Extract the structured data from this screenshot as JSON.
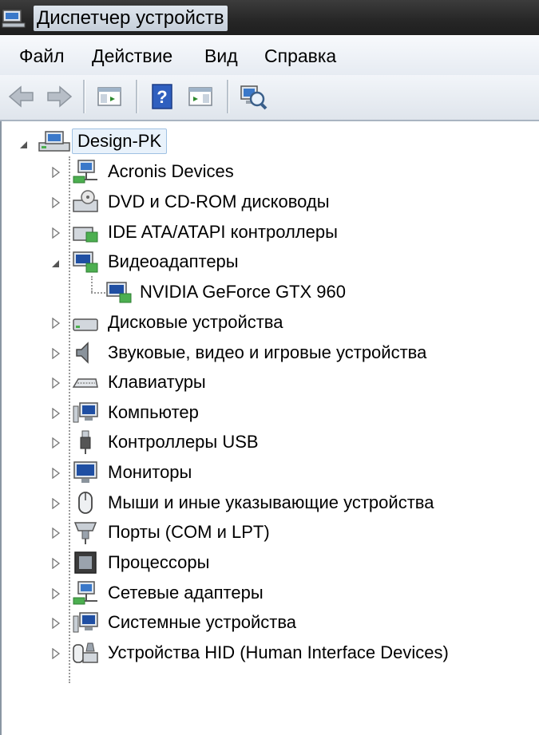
{
  "window": {
    "title": "Диспетчер устройств"
  },
  "menu": [
    {
      "label": "Файл"
    },
    {
      "label": "Действие"
    },
    {
      "label": "Вид"
    },
    {
      "label": "Справка"
    }
  ],
  "tree": {
    "root": {
      "label": "Design-PK"
    },
    "items": [
      {
        "label": "Acronis Devices",
        "icon": "network-adapter-icon"
      },
      {
        "label": "DVD и CD-ROM дисководы",
        "icon": "optical-drive-icon"
      },
      {
        "label": "IDE ATA/ATAPI контроллеры",
        "icon": "ide-controller-icon"
      },
      {
        "label": "Видеоадаптеры",
        "icon": "display-adapter-icon",
        "expanded": true,
        "children": [
          {
            "label": "NVIDIA GeForce GTX 960"
          }
        ]
      },
      {
        "label": "Дисковые устройства",
        "icon": "disk-drive-icon"
      },
      {
        "label": "Звуковые, видео и игровые устройства",
        "icon": "speaker-icon"
      },
      {
        "label": "Клавиатуры",
        "icon": "keyboard-icon"
      },
      {
        "label": "Компьютер",
        "icon": "computer-icon"
      },
      {
        "label": "Контроллеры USB",
        "icon": "usb-icon"
      },
      {
        "label": "Мониторы",
        "icon": "monitor-icon"
      },
      {
        "label": "Мыши и иные указывающие устройства",
        "icon": "mouse-icon"
      },
      {
        "label": "Порты (COM и LPT)",
        "icon": "port-icon"
      },
      {
        "label": "Процессоры",
        "icon": "processor-icon"
      },
      {
        "label": "Сетевые адаптеры",
        "icon": "network-adapter-icon"
      },
      {
        "label": "Системные устройства",
        "icon": "system-devices-icon"
      },
      {
        "label": "Устройства HID (Human Interface Devices)",
        "icon": "hid-icon"
      }
    ]
  }
}
